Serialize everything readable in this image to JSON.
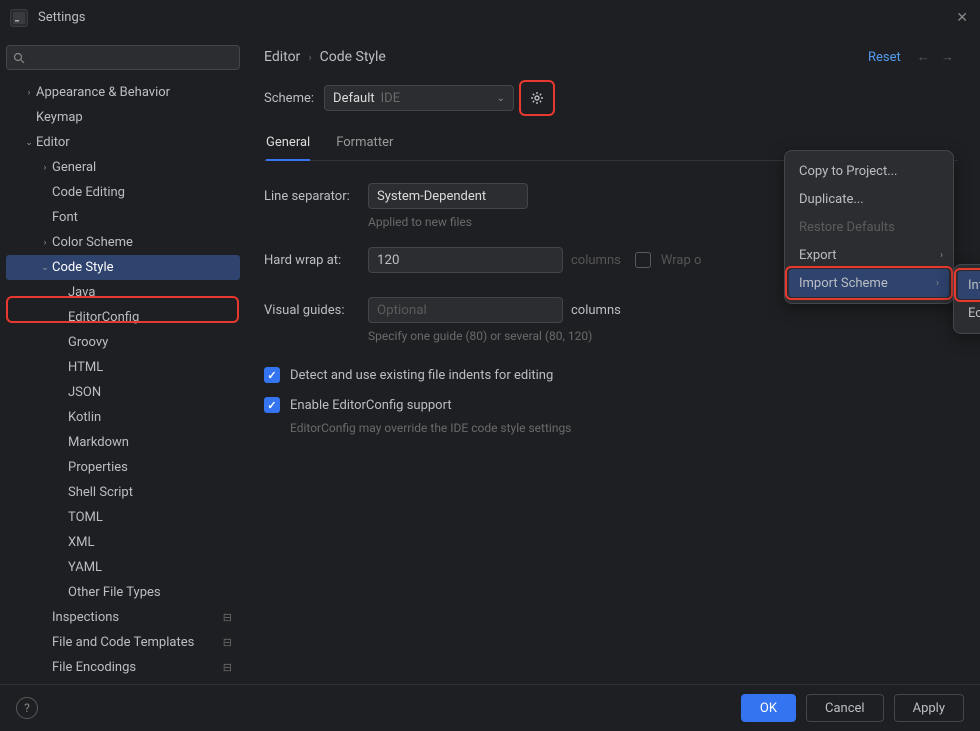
{
  "window": {
    "title": "Settings"
  },
  "search": {
    "placeholder": ""
  },
  "sidebar": [
    {
      "label": "Appearance & Behavior",
      "level": 1,
      "arrow": "right"
    },
    {
      "label": "Keymap",
      "level": 1,
      "arrow": ""
    },
    {
      "label": "Editor",
      "level": 1,
      "arrow": "down"
    },
    {
      "label": "General",
      "level": 2,
      "arrow": "right"
    },
    {
      "label": "Code Editing",
      "level": 2,
      "arrow": ""
    },
    {
      "label": "Font",
      "level": 2,
      "arrow": ""
    },
    {
      "label": "Color Scheme",
      "level": 2,
      "arrow": "right"
    },
    {
      "label": "Code Style",
      "level": 2,
      "arrow": "down",
      "selected": true,
      "highlight": true
    },
    {
      "label": "Java",
      "level": 3,
      "arrow": ""
    },
    {
      "label": "EditorConfig",
      "level": 3,
      "arrow": ""
    },
    {
      "label": "Groovy",
      "level": 3,
      "arrow": ""
    },
    {
      "label": "HTML",
      "level": 3,
      "arrow": ""
    },
    {
      "label": "JSON",
      "level": 3,
      "arrow": ""
    },
    {
      "label": "Kotlin",
      "level": 3,
      "arrow": ""
    },
    {
      "label": "Markdown",
      "level": 3,
      "arrow": ""
    },
    {
      "label": "Properties",
      "level": 3,
      "arrow": ""
    },
    {
      "label": "Shell Script",
      "level": 3,
      "arrow": ""
    },
    {
      "label": "TOML",
      "level": 3,
      "arrow": ""
    },
    {
      "label": "XML",
      "level": 3,
      "arrow": ""
    },
    {
      "label": "YAML",
      "level": 3,
      "arrow": ""
    },
    {
      "label": "Other File Types",
      "level": 3,
      "arrow": ""
    },
    {
      "label": "Inspections",
      "level": 2,
      "arrow": "",
      "sep": true
    },
    {
      "label": "File and Code Templates",
      "level": 2,
      "arrow": "",
      "sep": true
    },
    {
      "label": "File Encodings",
      "level": 2,
      "arrow": "",
      "sep": true
    }
  ],
  "breadcrumb": {
    "a": "Editor",
    "b": "Code Style"
  },
  "reset": "Reset",
  "scheme": {
    "label": "Scheme:",
    "value": "Default",
    "hint": "IDE"
  },
  "tabs": {
    "general": "General",
    "formatter": "Formatter"
  },
  "form": {
    "lineSep": {
      "label": "Line separator:",
      "value": "System-Dependent",
      "hint": "Applied to new files"
    },
    "hardWrap": {
      "label": "Hard wrap at:",
      "value": "120",
      "columns": "columns",
      "wrapCb": "Wrap o"
    },
    "visual": {
      "label": "Visual guides:",
      "placeholder": "Optional",
      "columns": "columns",
      "hint": "Specify one guide (80) or several (80, 120)"
    },
    "detect": "Detect and use existing file indents for editing",
    "ec": "Enable EditorConfig support",
    "ecHint": "EditorConfig may override the IDE code style settings"
  },
  "menu1": [
    {
      "label": "Copy to Project...",
      "state": ""
    },
    {
      "label": "Duplicate...",
      "state": ""
    },
    {
      "label": "Restore Defaults",
      "state": "disabled"
    },
    {
      "label": "Export",
      "state": "",
      "sub": true
    },
    {
      "label": "Import Scheme",
      "state": "hovered",
      "sub": true,
      "highlight": true
    }
  ],
  "menu2": [
    {
      "label": "IntelliJ IDEA code style XML",
      "state": "hovered",
      "highlight": true
    },
    {
      "label": "Eclipse XML Profile",
      "state": ""
    }
  ],
  "buttons": {
    "ok": "OK",
    "cancel": "Cancel",
    "apply": "Apply"
  }
}
